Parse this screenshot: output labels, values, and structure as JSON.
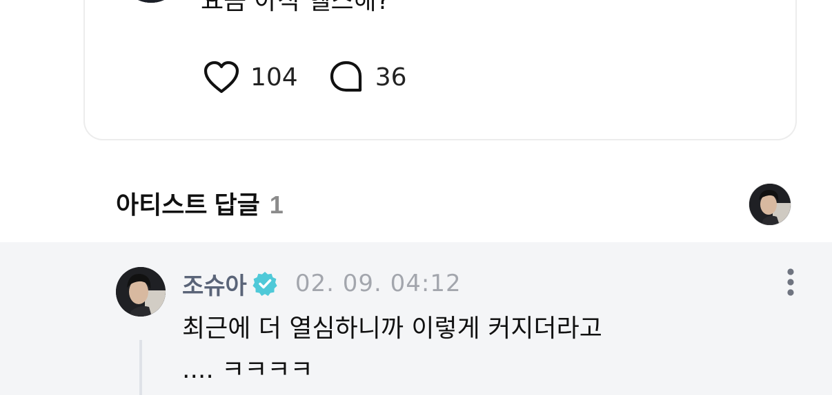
{
  "post": {
    "text": "요즘 아직 헬스해?",
    "like_count": "104",
    "comment_count": "36",
    "icons": {
      "like": "heart-outline-icon",
      "comment": "speech-bubble-icon"
    }
  },
  "artist_replies": {
    "title": "아티스트 답글",
    "count": "1"
  },
  "reply": {
    "author": "조슈아",
    "timestamp": "02. 09. 04:12",
    "line1": "최근에 더 열심하니까 이렇게 커지더라고",
    "line2": ".... ㅋㅋㅋㅋ",
    "verified_color": "#4fc9d8",
    "icons": {
      "verified": "verified-badge-icon",
      "more": "more-vertical-icon"
    }
  },
  "colors": {
    "reply_background": "#f4f5f7",
    "author_name": "#5a6478",
    "timestamp": "#a3a6ad",
    "count_muted": "#8b8b8b"
  }
}
